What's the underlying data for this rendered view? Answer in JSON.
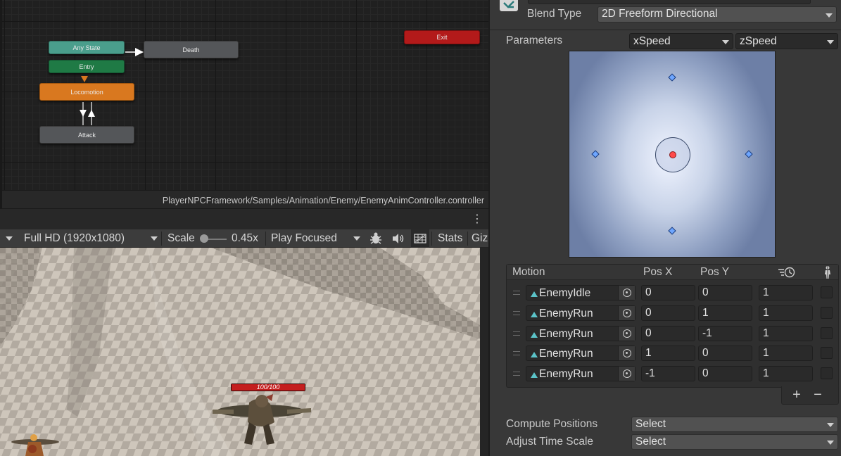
{
  "animator": {
    "nodes": {
      "any_state": "Any State",
      "entry": "Entry",
      "locomotion": "Locomotion",
      "attack": "Attack",
      "death": "Death",
      "exit": "Exit"
    },
    "path": "PlayerNPCFramework/Samples/Animation/Enemy/EnemyAnimController.controller"
  },
  "game_toolbar": {
    "resolution": "Full HD (1920x1080)",
    "scale_label": "Scale",
    "scale_value": "0.45x",
    "play_mode": "Play Focused",
    "stats_label": "Stats",
    "gizmos_label": "Giz"
  },
  "game_view": {
    "health_text": "100/100",
    "health_fraction": 1.0
  },
  "inspector": {
    "blend_type_label": "Blend Type",
    "blend_type_value": "2D Freeform Directional",
    "parameters_label": "Parameters",
    "param_x": "xSpeed",
    "param_y": "zSpeed",
    "motion_headers": {
      "motion": "Motion",
      "pos_x": "Pos X",
      "pos_y": "Pos Y"
    },
    "motions": [
      {
        "name": "EnemyIdle",
        "pos_x": "0",
        "pos_y": "0",
        "speed": "1"
      },
      {
        "name": "EnemyRun",
        "pos_x": "0",
        "pos_y": "1",
        "speed": "1"
      },
      {
        "name": "EnemyRun",
        "pos_x": "0",
        "pos_y": "-1",
        "speed": "1"
      },
      {
        "name": "EnemyRun",
        "pos_x": "1",
        "pos_y": "0",
        "speed": "1"
      },
      {
        "name": "EnemyRun",
        "pos_x": "-1",
        "pos_y": "0",
        "speed": "1"
      }
    ],
    "add_symbol": "+",
    "remove_symbol": "−",
    "compute_positions_label": "Compute Positions",
    "compute_positions_value": "Select",
    "adjust_time_scale_label": "Adjust Time Scale",
    "adjust_time_scale_value": "Select"
  },
  "colors": {
    "entry_node": "#1f7a45",
    "any_state_node": "#4a9e8c",
    "locomotion_node": "#d9781f",
    "exit_node": "#b31a1a",
    "clip_icon": "#5bc3c8",
    "blend_point": "#6ea6ff",
    "blend_cursor": "#ff4a4a"
  },
  "icons": [
    "options-icon",
    "bug-icon",
    "audio-icon",
    "grid-icon",
    "pick-target-icon",
    "speed-clock-icon",
    "mirror-figure-icon",
    "blend-tree-icon"
  ]
}
